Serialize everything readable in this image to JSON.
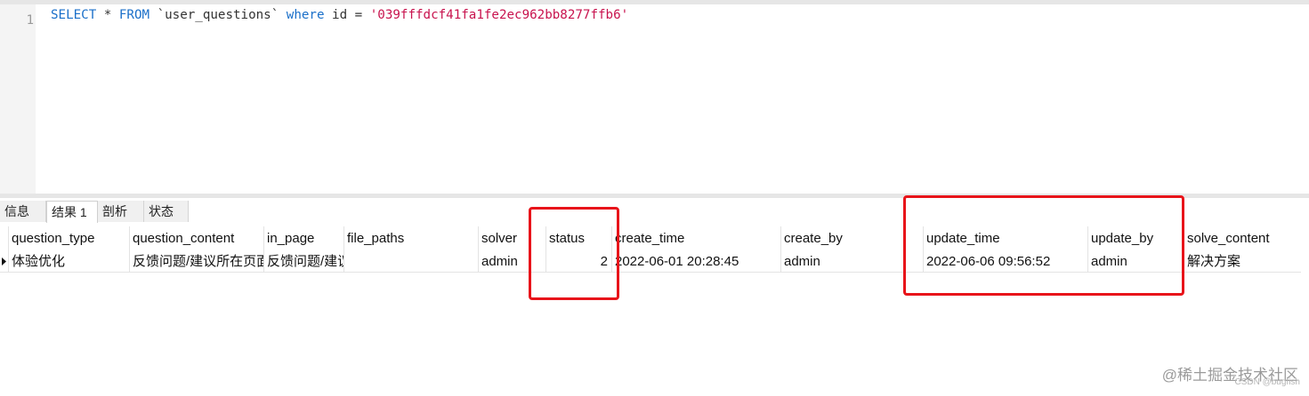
{
  "editor": {
    "line_number": "1",
    "sql": {
      "k1": "SELECT",
      "p1": " * ",
      "k2": "FROM",
      "p2": " `user_questions` ",
      "k3": "where",
      "p3": " id = ",
      "s1": "'039fffdcf41fa1fe2ec962bb8277ffb6'"
    }
  },
  "tabs": [
    "信息",
    "结果 1",
    "剖析",
    "状态"
  ],
  "active_tab": "结果 1",
  "grid": {
    "columns": [
      "question_type",
      "question_content",
      "in_page",
      "file_paths",
      "solver",
      "status",
      "create_time",
      "create_by",
      "update_time",
      "update_by",
      "solve_content"
    ],
    "row": [
      "体验优化",
      "反馈问题/建议所在页面",
      "反馈问题/建议",
      "",
      "admin",
      "2",
      "2022-06-01 20:28:45",
      "admin",
      "2022-06-06 09:56:52",
      "admin",
      "解决方案"
    ]
  },
  "annotation_color": "#e8141a",
  "watermark": "@稀土掘金技术社区",
  "watermark_small": "CSDN @bugfish"
}
